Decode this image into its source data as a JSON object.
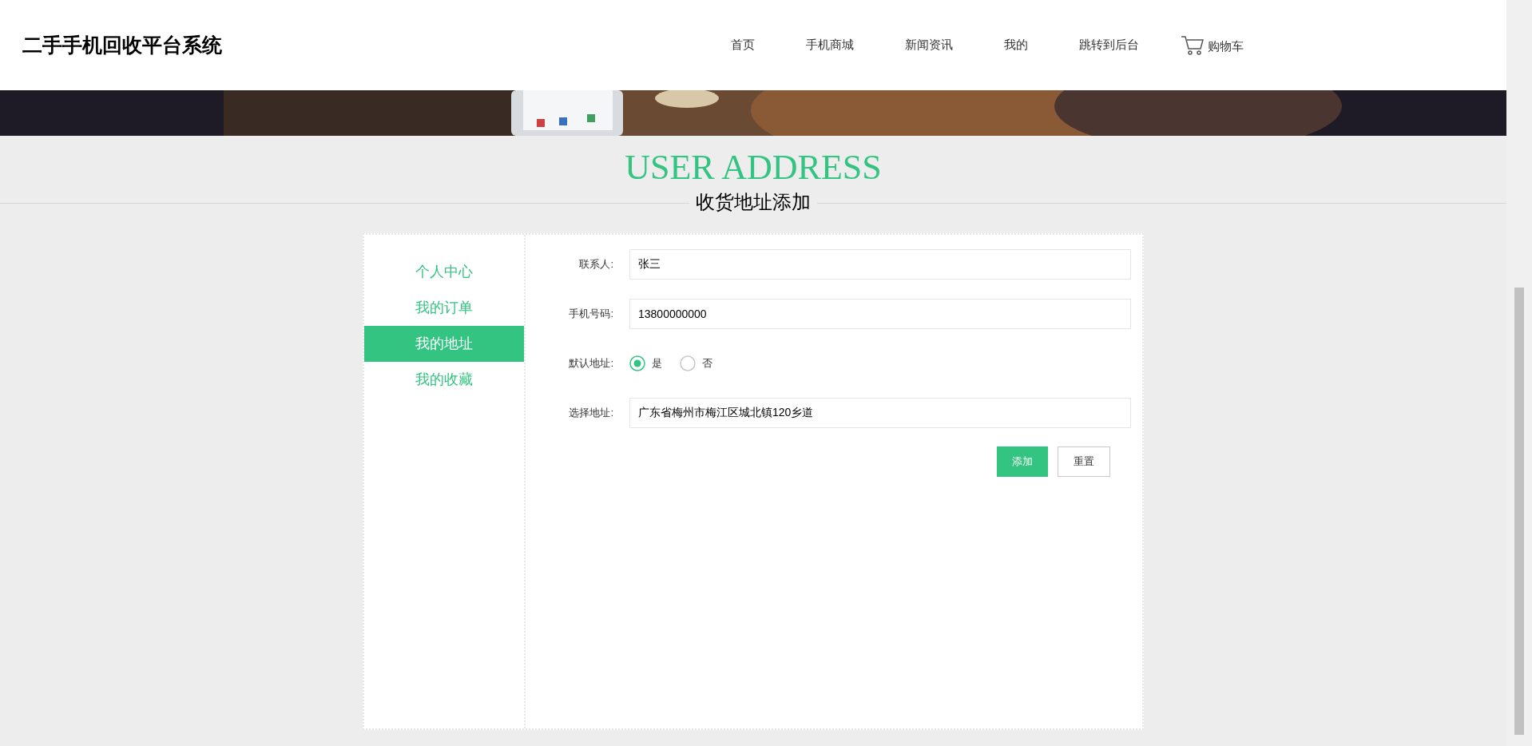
{
  "site_title": "二手手机回收平台系统",
  "nav": [
    {
      "label": "首页",
      "kind": "link"
    },
    {
      "label": "手机商城",
      "kind": "link"
    },
    {
      "label": "新闻资讯",
      "kind": "link"
    },
    {
      "label": "我的",
      "kind": "link"
    },
    {
      "label": "跳转到后台",
      "kind": "link"
    },
    {
      "label": "购物车",
      "kind": "cart"
    }
  ],
  "heading": {
    "title": "USER ADDRESS",
    "subtitle": "收货地址添加"
  },
  "sidebar": {
    "items": [
      {
        "label": "个人中心",
        "selected": false
      },
      {
        "label": "我的订单",
        "selected": false
      },
      {
        "label": "我的地址",
        "selected": true
      },
      {
        "label": "我的收藏",
        "selected": false
      }
    ]
  },
  "form": {
    "fields": [
      {
        "label": "联系人:",
        "kind": "text",
        "value": "张三"
      },
      {
        "label": "手机号码:",
        "kind": "text",
        "value": "13800000000"
      },
      {
        "label": "默认地址:",
        "kind": "radio",
        "options": [
          {
            "label": "是",
            "selected": true
          },
          {
            "label": "否",
            "selected": false
          }
        ]
      },
      {
        "label": "选择地址:",
        "kind": "text",
        "value": "广东省梅州市梅江区城北镇120乡道"
      }
    ],
    "buttons": [
      {
        "label": "添加",
        "kind": "primary"
      },
      {
        "label": "重置",
        "kind": "secondary"
      }
    ]
  }
}
